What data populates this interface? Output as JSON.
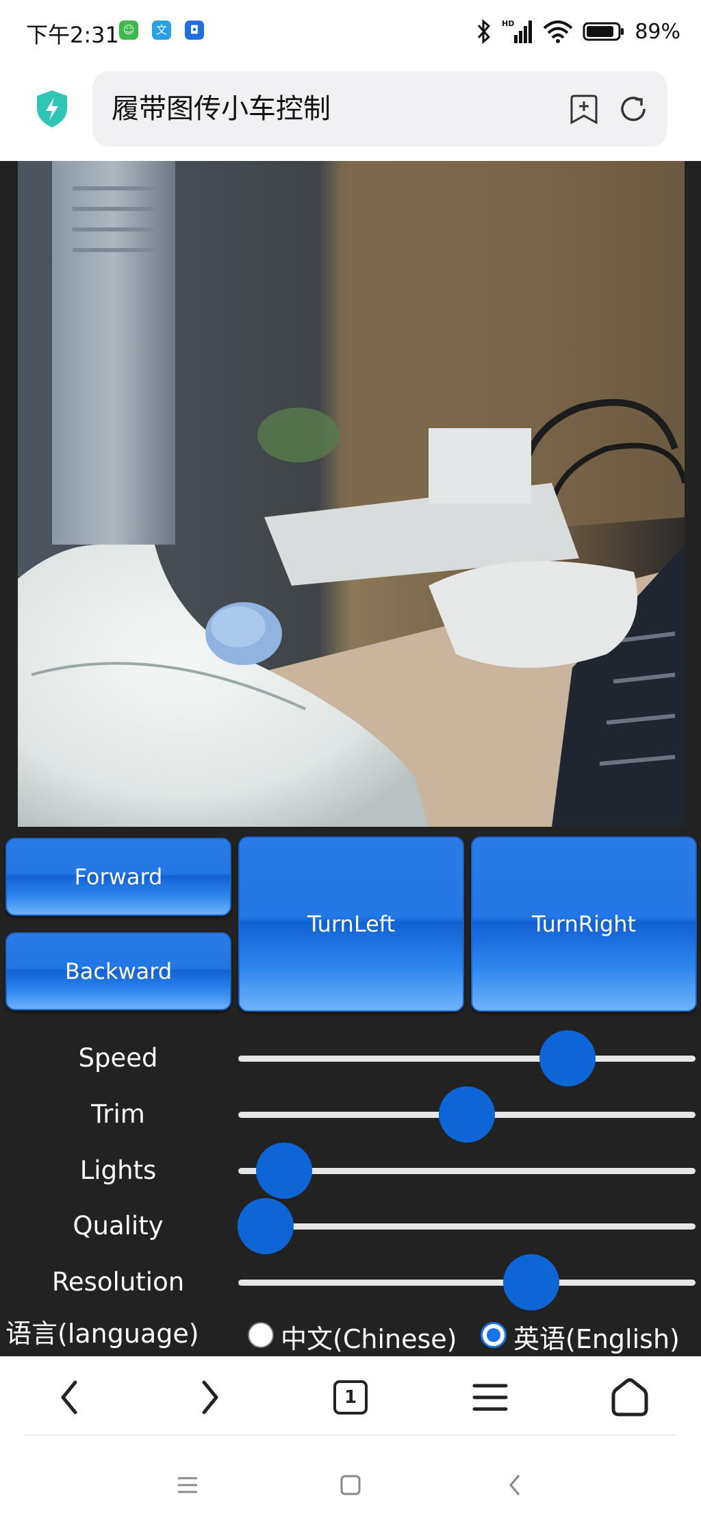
{
  "status_bar": {
    "time": "下午2:31",
    "battery_percent": "89%",
    "battery_level": 0.89,
    "notification_icons": [
      "app-green-icon",
      "app-blue-icon",
      "app-shield-icon"
    ]
  },
  "browser": {
    "page_title": "履带图传小车控制",
    "tab_count": "1",
    "icons": {
      "security": "shield-bolt-icon",
      "bookmark": "bookmark-add-icon",
      "reload": "reload-icon"
    }
  },
  "controls": {
    "forward_label": "Forward",
    "backward_label": "Backward",
    "turn_left_label": "TurnLeft",
    "turn_right_label": "TurnRight"
  },
  "sliders": [
    {
      "label": "Speed",
      "value": 0.72
    },
    {
      "label": "Trim",
      "value": 0.5
    },
    {
      "label": "Lights",
      "value": 0.1
    },
    {
      "label": "Quality",
      "value": 0.06
    },
    {
      "label": "Resolution",
      "value": 0.64
    }
  ],
  "language": {
    "label": "语言(language)",
    "options": [
      {
        "label": "中文(Chinese)",
        "checked": false
      },
      {
        "label": "英语(English)",
        "checked": true
      }
    ]
  },
  "colors": {
    "button_blue": "#2377e4",
    "slider_thumb": "#0e65d6",
    "page_background": "#222222",
    "security_shield": "#2ec4b6"
  }
}
